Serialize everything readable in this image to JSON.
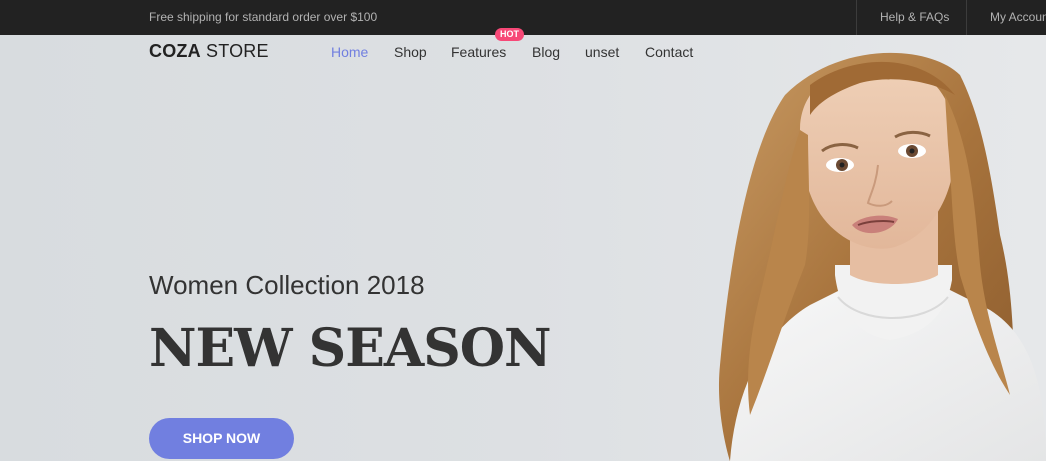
{
  "topbar": {
    "promo": "Free shipping for standard order over $100",
    "help_link": "Help & FAQs",
    "account_link": "My Account"
  },
  "header": {
    "logo_bold": "COZA",
    "logo_light": "STORE",
    "nav": [
      {
        "label": "Home",
        "active": true
      },
      {
        "label": "Shop",
        "active": false
      },
      {
        "label": "Features",
        "active": false,
        "badge": "HOT"
      },
      {
        "label": "Blog",
        "active": false
      },
      {
        "label": "unset",
        "active": false
      },
      {
        "label": "Contact",
        "active": false
      }
    ]
  },
  "hero": {
    "subtitle": "Women Collection 2018",
    "title": "NEW SEASON",
    "cta": "SHOP NOW"
  },
  "colors": {
    "accent": "#717fe0",
    "hot_badge": "#f74877",
    "topbar_bg": "#222222",
    "hero_bg": "#dde1e4"
  }
}
